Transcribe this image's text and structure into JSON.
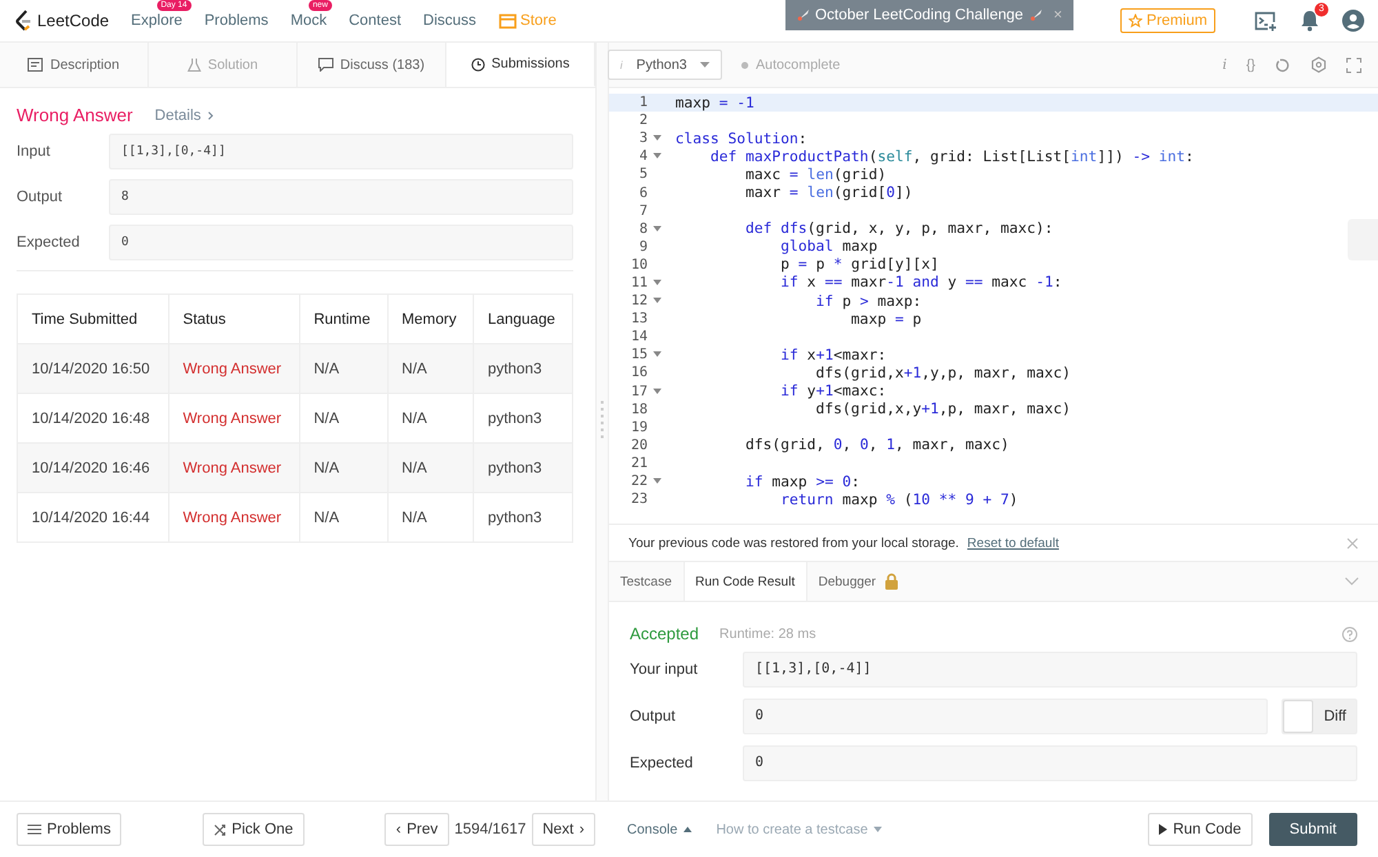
{
  "nav": {
    "logo": "LeetCode",
    "items": [
      {
        "label": "Explore",
        "badge": "Day 14"
      },
      {
        "label": "Problems"
      },
      {
        "label": "Mock",
        "badge": "new"
      },
      {
        "label": "Contest"
      },
      {
        "label": "Discuss"
      }
    ],
    "store": "Store",
    "banner": {
      "text": "October LeetCoding Challenge",
      "close": "×"
    },
    "premium": "Premium",
    "notifications": "3"
  },
  "left_tabs": [
    {
      "label": "Description",
      "kind": "description",
      "selected": false,
      "disabled": false
    },
    {
      "label": "Solution",
      "kind": "solution",
      "selected": false,
      "disabled": true
    },
    {
      "label": "Discuss (183)",
      "kind": "discuss",
      "selected": false,
      "disabled": false
    },
    {
      "label": "Submissions",
      "kind": "submissions",
      "selected": true,
      "disabled": false
    }
  ],
  "editor_toolbar": {
    "language_glyph": "i",
    "language": "Python3",
    "autocomplete": "Autocomplete",
    "info_glyph": "i",
    "format_glyph": "{}"
  },
  "result": {
    "status": "Wrong Answer",
    "details": "Details",
    "fields": [
      {
        "label": "Input",
        "value": "[[1,3],[0,-4]]"
      },
      {
        "label": "Output",
        "value": "8"
      },
      {
        "label": "Expected",
        "value": "0"
      }
    ]
  },
  "table": {
    "columns": [
      "Time Submitted",
      "Status",
      "Runtime",
      "Memory",
      "Language"
    ],
    "rows": [
      {
        "time": "10/14/2020 16:50",
        "status": "Wrong Answer",
        "runtime": "N/A",
        "memory": "N/A",
        "language": "python3"
      },
      {
        "time": "10/14/2020 16:48",
        "status": "Wrong Answer",
        "runtime": "N/A",
        "memory": "N/A",
        "language": "python3"
      },
      {
        "time": "10/14/2020 16:46",
        "status": "Wrong Answer",
        "runtime": "N/A",
        "memory": "N/A",
        "language": "python3"
      },
      {
        "time": "10/14/2020 16:44",
        "status": "Wrong Answer",
        "runtime": "N/A",
        "memory": "N/A",
        "language": "python3"
      }
    ]
  },
  "code": [
    {
      "num": "1",
      "fold": false,
      "active": true,
      "tokens": [
        {
          "text": "maxp ",
          "kind": "plain"
        },
        {
          "text": "= -1",
          "kind": "keyword"
        }
      ]
    },
    {
      "num": "2",
      "fold": false,
      "active": false
    },
    {
      "num": "3",
      "fold": true,
      "active": false,
      "tokens": [
        {
          "text": "class Solution",
          "kind": "keyword"
        },
        {
          "text": ":",
          "kind": "plain"
        }
      ]
    },
    {
      "num": "4",
      "fold": true,
      "active": false,
      "tokens": [
        {
          "text": "    def maxProductPath",
          "kind": "keyword"
        },
        {
          "text": "(",
          "kind": "plain"
        },
        {
          "text": "self",
          "kind": "self"
        },
        {
          "text": ", grid: List[List[",
          "kind": "plain"
        },
        {
          "text": "int",
          "kind": "builtin"
        },
        {
          "text": "]]) ",
          "kind": "plain"
        },
        {
          "text": "-> ",
          "kind": "keyword"
        },
        {
          "text": "int",
          "kind": "builtin"
        },
        {
          "text": ":",
          "kind": "plain"
        }
      ]
    },
    {
      "num": "5",
      "fold": false,
      "active": false,
      "tokens": [
        {
          "text": "        maxc ",
          "kind": "plain"
        },
        {
          "text": "= ",
          "kind": "keyword"
        },
        {
          "text": "len",
          "kind": "builtin"
        },
        {
          "text": "(grid)",
          "kind": "plain"
        }
      ]
    },
    {
      "num": "6",
      "fold": false,
      "active": false,
      "tokens": [
        {
          "text": "        maxr ",
          "kind": "plain"
        },
        {
          "text": "= ",
          "kind": "keyword"
        },
        {
          "text": "len",
          "kind": "builtin"
        },
        {
          "text": "(grid[",
          "kind": "plain"
        },
        {
          "text": "0",
          "kind": "keyword"
        },
        {
          "text": "])",
          "kind": "plain"
        }
      ]
    },
    {
      "num": "7",
      "fold": false,
      "active": false
    },
    {
      "num": "8",
      "fold": true,
      "active": false,
      "tokens": [
        {
          "text": "        def dfs",
          "kind": "keyword"
        },
        {
          "text": "(grid, x, y, p, maxr, maxc):",
          "kind": "plain"
        }
      ]
    },
    {
      "num": "9",
      "fold": false,
      "active": false,
      "tokens": [
        {
          "text": "            global ",
          "kind": "keyword"
        },
        {
          "text": "maxp",
          "kind": "plain"
        }
      ]
    },
    {
      "num": "10",
      "fold": false,
      "active": false,
      "tokens": [
        {
          "text": "            p ",
          "kind": "plain"
        },
        {
          "text": "=",
          "kind": "keyword"
        },
        {
          "text": " p ",
          "kind": "plain"
        },
        {
          "text": "*",
          "kind": "keyword"
        },
        {
          "text": " grid[y][x]",
          "kind": "plain"
        }
      ]
    },
    {
      "num": "11",
      "fold": true,
      "active": false,
      "tokens": [
        {
          "text": "            if",
          "kind": "keyword"
        },
        {
          "text": " x ",
          "kind": "plain"
        },
        {
          "text": "==",
          "kind": "keyword"
        },
        {
          "text": " maxr",
          "kind": "plain"
        },
        {
          "text": "-1 and",
          "kind": "keyword"
        },
        {
          "text": " y ",
          "kind": "plain"
        },
        {
          "text": "==",
          "kind": "keyword"
        },
        {
          "text": " maxc ",
          "kind": "plain"
        },
        {
          "text": "-1",
          "kind": "keyword"
        },
        {
          "text": ":",
          "kind": "plain"
        }
      ]
    },
    {
      "num": "12",
      "fold": true,
      "active": false,
      "tokens": [
        {
          "text": "                if",
          "kind": "keyword"
        },
        {
          "text": " p ",
          "kind": "plain"
        },
        {
          "text": ">",
          "kind": "keyword"
        },
        {
          "text": " maxp:",
          "kind": "plain"
        }
      ]
    },
    {
      "num": "13",
      "fold": false,
      "active": false,
      "tokens": [
        {
          "text": "                    maxp ",
          "kind": "plain"
        },
        {
          "text": "=",
          "kind": "keyword"
        },
        {
          "text": " p",
          "kind": "plain"
        }
      ]
    },
    {
      "num": "14",
      "fold": false,
      "active": false
    },
    {
      "num": "15",
      "fold": true,
      "active": false,
      "tokens": [
        {
          "text": "            if",
          "kind": "keyword"
        },
        {
          "text": " x",
          "kind": "plain"
        },
        {
          "text": "+1",
          "kind": "keyword"
        },
        {
          "text": "<maxr:",
          "kind": "plain"
        }
      ]
    },
    {
      "num": "16",
      "fold": false,
      "active": false,
      "tokens": [
        {
          "text": "                dfs(grid,x",
          "kind": "plain"
        },
        {
          "text": "+1",
          "kind": "keyword"
        },
        {
          "text": ",y,p, maxr, maxc)",
          "kind": "plain"
        }
      ]
    },
    {
      "num": "17",
      "fold": true,
      "active": false,
      "tokens": [
        {
          "text": "            if",
          "kind": "keyword"
        },
        {
          "text": " y",
          "kind": "plain"
        },
        {
          "text": "+1",
          "kind": "keyword"
        },
        {
          "text": "<maxc:",
          "kind": "plain"
        }
      ]
    },
    {
      "num": "18",
      "fold": false,
      "active": false,
      "tokens": [
        {
          "text": "                dfs(grid,x,y",
          "kind": "plain"
        },
        {
          "text": "+1",
          "kind": "keyword"
        },
        {
          "text": ",p, maxr, maxc)",
          "kind": "plain"
        }
      ]
    },
    {
      "num": "19",
      "fold": false,
      "active": false
    },
    {
      "num": "20",
      "fold": false,
      "active": false,
      "tokens": [
        {
          "text": "        dfs(grid, ",
          "kind": "plain"
        },
        {
          "text": "0",
          "kind": "keyword"
        },
        {
          "text": ", ",
          "kind": "plain"
        },
        {
          "text": "0",
          "kind": "keyword"
        },
        {
          "text": ", ",
          "kind": "plain"
        },
        {
          "text": "1",
          "kind": "keyword"
        },
        {
          "text": ", maxr, maxc)",
          "kind": "plain"
        }
      ]
    },
    {
      "num": "21",
      "fold": false,
      "active": false
    },
    {
      "num": "22",
      "fold": true,
      "active": false,
      "tokens": [
        {
          "text": "        if",
          "kind": "keyword"
        },
        {
          "text": " maxp ",
          "kind": "plain"
        },
        {
          "text": ">= 0",
          "kind": "keyword"
        },
        {
          "text": ":",
          "kind": "plain"
        }
      ]
    },
    {
      "num": "23",
      "fold": false,
      "active": false,
      "tokens": [
        {
          "text": "            return ",
          "kind": "keyword"
        },
        {
          "text": "maxp ",
          "kind": "plain"
        },
        {
          "text": "%",
          "kind": "keyword"
        },
        {
          "text": " (",
          "kind": "plain"
        },
        {
          "text": "10 ** 9 + 7",
          "kind": "keyword"
        },
        {
          "text": ")",
          "kind": "plain"
        }
      ]
    }
  ],
  "notice": {
    "text": "Your previous code was restored from your local storage.",
    "link": "Reset to default"
  },
  "console_tabs": [
    {
      "label": "Testcase",
      "selected": false,
      "locked": false
    },
    {
      "label": "Run Code Result",
      "selected": true,
      "locked": false
    },
    {
      "label": "Debugger",
      "selected": false,
      "locked": true
    }
  ],
  "run_result": {
    "status": "Accepted",
    "runtime": "Runtime: 28 ms",
    "fields": [
      {
        "label": "Your input",
        "value": "[[1,3],[0,-4]]"
      },
      {
        "label": "Output",
        "value": "0",
        "diff": {
          "label": "Diff",
          "on": false
        }
      },
      {
        "label": "Expected",
        "value": "0"
      }
    ]
  },
  "bottom": {
    "problems": "Problems",
    "pick": "Pick One",
    "prev_arrow": "‹",
    "prev": "Prev",
    "counter": "1594/1617",
    "next": "Next",
    "next_arrow": "›",
    "console": "Console",
    "howto": "How to create a testcase",
    "run": "Run Code",
    "submit": "Submit"
  }
}
